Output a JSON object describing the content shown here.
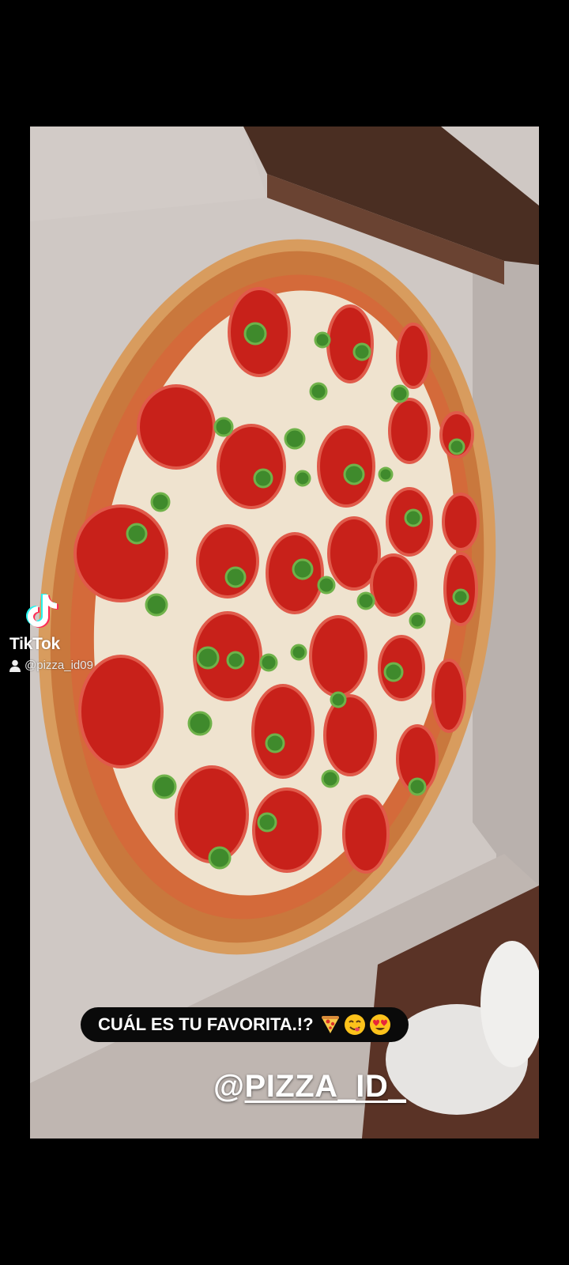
{
  "watermark": {
    "brand": "TikTok",
    "username": "@pizza_id09",
    "logo_icon": "tiktok-logo-icon",
    "user_icon": "person-icon"
  },
  "caption": {
    "text": "CUÁL ES TU FAVORITA.!?",
    "emojis": [
      "pizza-emoji",
      "yum-face-emoji",
      "heart-eyes-emoji"
    ]
  },
  "handle_overlay": {
    "at": "@",
    "name": "PIZZA_ID_"
  },
  "photo": {
    "subject": "pizza-photo"
  },
  "colors": {
    "background": "#000000",
    "pill": "#0a0a0a",
    "text": "#ffffff"
  }
}
